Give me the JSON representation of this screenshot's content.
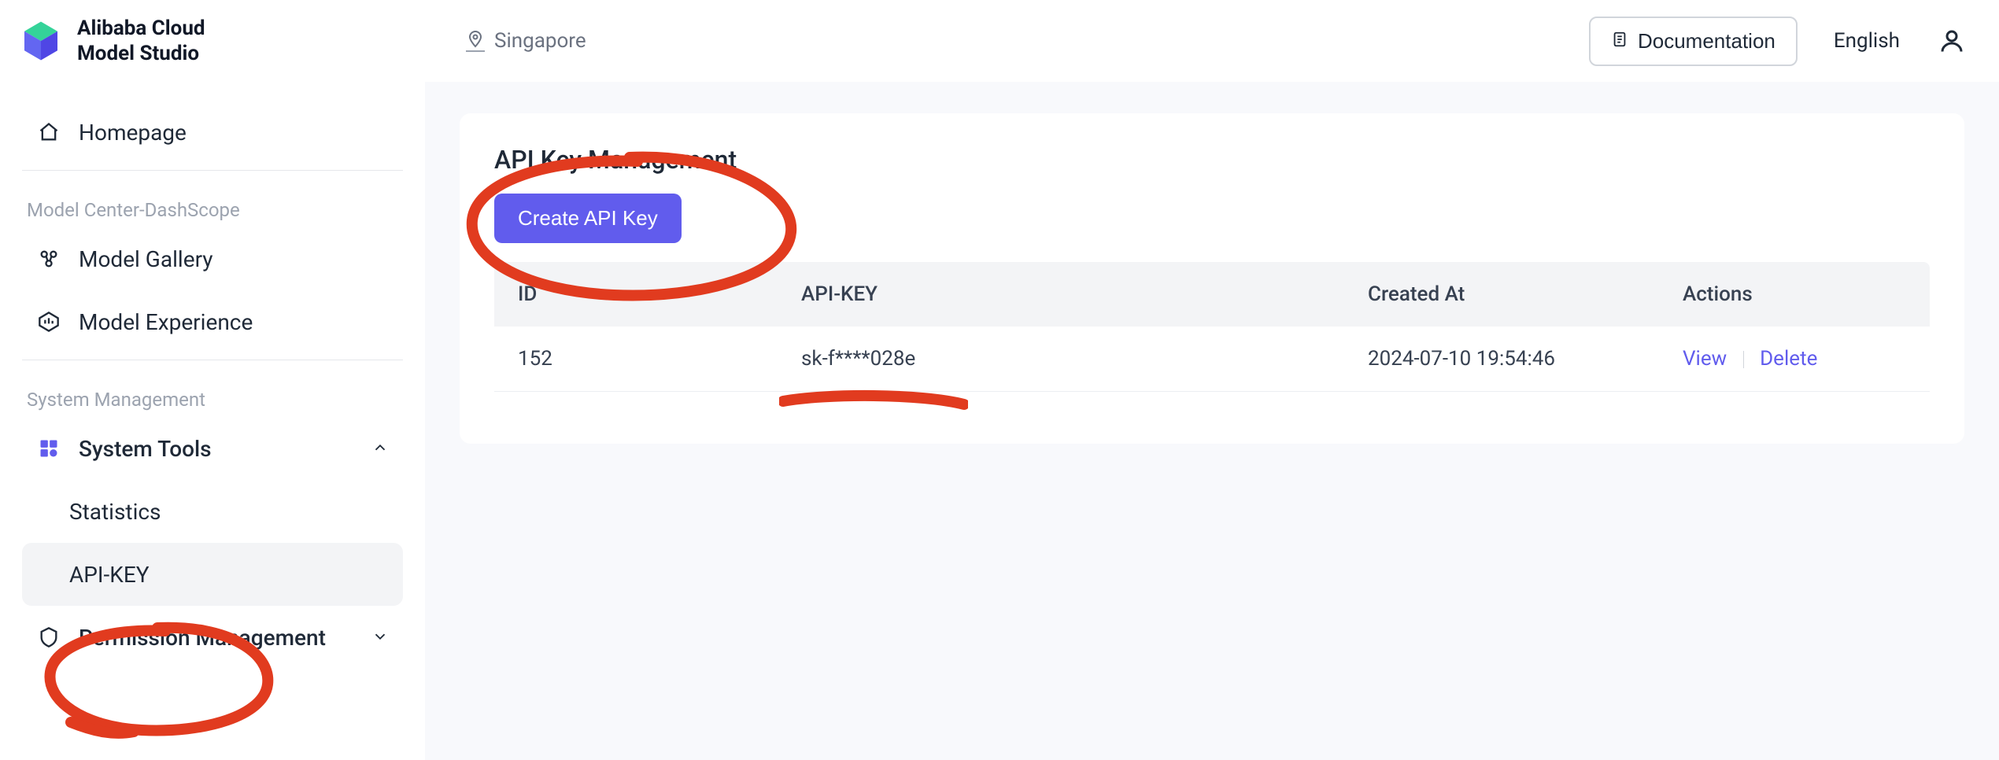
{
  "brand": {
    "line1": "Alibaba Cloud",
    "line2": "Model Studio"
  },
  "region": {
    "label": "Singapore"
  },
  "header": {
    "documentation_label": "Documentation",
    "language_label": "English"
  },
  "sidebar": {
    "homepage": "Homepage",
    "section_model_center": "Model Center-DashScope",
    "model_gallery": "Model Gallery",
    "model_experience": "Model Experience",
    "section_system_mgmt": "System Management",
    "system_tools": "System Tools",
    "statistics": "Statistics",
    "api_key": "API-KEY",
    "permission_mgmt": "Permission Management"
  },
  "page": {
    "title": "API Key Management",
    "create_btn": "Create API Key"
  },
  "table": {
    "headers": {
      "id": "ID",
      "key": "API-KEY",
      "created": "Created At",
      "actions": "Actions"
    },
    "actions": {
      "view": "View",
      "delete": "Delete"
    },
    "rows": [
      {
        "id": "152",
        "key": "sk-f****028e",
        "created": "2024-07-10 19:54:46"
      }
    ]
  },
  "colors": {
    "accent": "#615ced",
    "annotation": "#e13b1f"
  }
}
